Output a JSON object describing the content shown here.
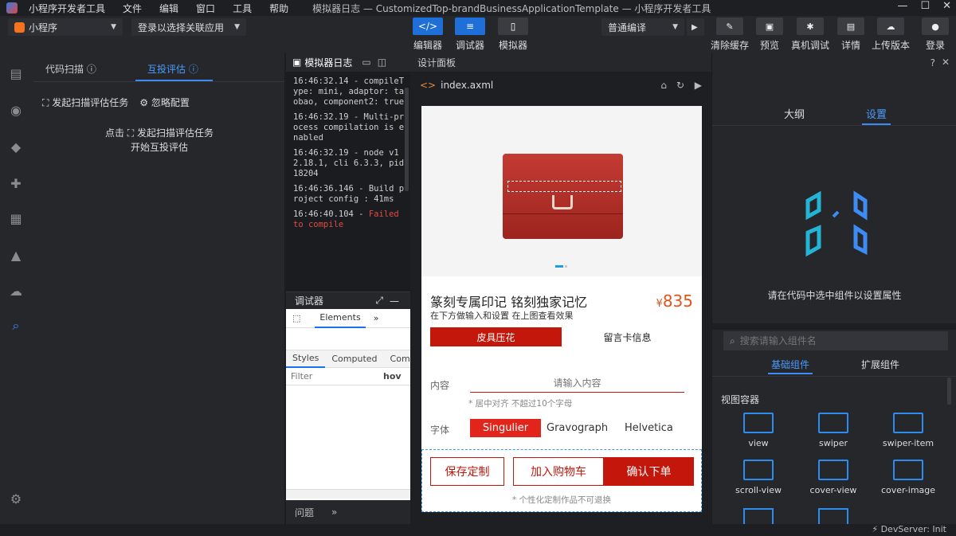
{
  "titlebar": {
    "menu": [
      "小程序开发者工具",
      "文件",
      "编辑",
      "窗口",
      "工具",
      "帮助"
    ],
    "window_title": "模拟器日志 — CustomizedTop-brandBusinessApplicationTemplate — 小程序开发者工具",
    "controls": [
      "—",
      "☐",
      "✕"
    ]
  },
  "toolbar": {
    "project_type": "小程序",
    "login_select": "登录以选择关联应用",
    "mode_buttons": [
      {
        "label": "编辑器",
        "icon": "</>"
      },
      {
        "label": "调试器",
        "icon": "≡"
      },
      {
        "label": "模拟器",
        "icon": "▯"
      }
    ],
    "compile_mode": "普通编译",
    "actions": [
      "清除缓存",
      "预览",
      "真机调试",
      "详情",
      "上传版本",
      "登录"
    ]
  },
  "left_panel": {
    "tabs": [
      "代码扫描",
      "互投评估"
    ],
    "actions": [
      "发起扫描评估任务",
      "忽略配置"
    ],
    "hint_prefix": "点击",
    "hint_action": "发起扫描评估任务",
    "hint_line2": "开始互投评估"
  },
  "console": {
    "title": "模拟器日志",
    "logs": [
      {
        "text": "16:46:32.14 - compileType: mini, adaptor: taobao, component2: true",
        "error": false
      },
      {
        "text": "16:46:32.19 - Multi-process compilation is enabled",
        "error": false
      },
      {
        "text": "16:46:32.19 - node v12.18.1, cli 6.3.3, pid 18204",
        "error": false
      },
      {
        "text": "16:46:36.146 - Build project config : 41ms",
        "error": false
      },
      {
        "time": "16:46:40.104 - ",
        "text": "Failed to compile",
        "error": true
      }
    ]
  },
  "debugger": {
    "title": "调试器",
    "tab": "Elements",
    "subtabs": [
      "Styles",
      "Computed",
      "Comp"
    ],
    "filter_placeholder": "Filter",
    "hov": "hov",
    "bottom_tab": "问题"
  },
  "design": {
    "title": "设计面板",
    "file": "index.axml",
    "product": {
      "title": "篆刻专属印记 铭刻独家记忆",
      "subtitle": "在下方做输入和设置 在上图查看效果",
      "price": "835",
      "currency": "¥",
      "tabs": [
        "皮具压花",
        "留言卡信息"
      ],
      "content_label": "内容",
      "content_placeholder": "请输入内容",
      "content_hint": "* 居中对齐 不超过10个字母",
      "font_label": "字体",
      "fonts": [
        "Singulier",
        "Gravograph",
        "Helvetica"
      ],
      "buttons": [
        "保存定制",
        "加入购物车",
        "确认下单"
      ],
      "notice": "* 个性化定制作品不可退换"
    }
  },
  "right_panel": {
    "tabs": [
      "大纲",
      "设置"
    ],
    "empty_hint": "请在代码中选中组件以设置属性",
    "search_placeholder": "搜索请输入组件名",
    "comp_tabs": [
      "基础组件",
      "扩展组件"
    ],
    "section": "视图容器",
    "components": [
      "view",
      "swiper",
      "swiper-item",
      "scroll-view",
      "cover-view",
      "cover-image"
    ]
  },
  "statusbar": {
    "text": "DevServer: Init"
  },
  "colors": {
    "accent": "#1f6fd8",
    "danger": "#c3170b",
    "price": "#e2541b"
  }
}
